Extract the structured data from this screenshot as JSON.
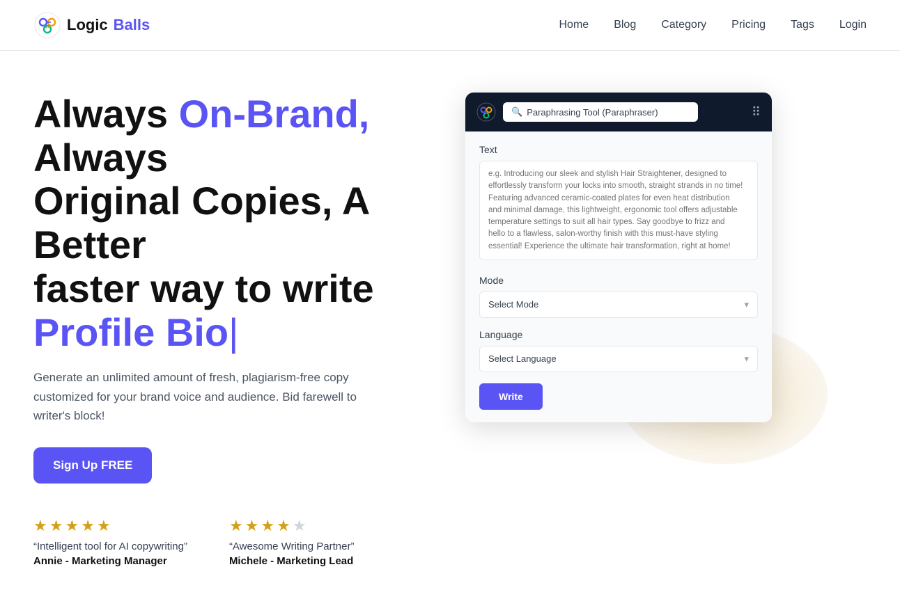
{
  "header": {
    "logo_logic": "Logic",
    "logo_balls": "Balls",
    "nav": {
      "home": "Home",
      "blog": "Blog",
      "category": "Category",
      "pricing": "Pricing",
      "tags": "Tags",
      "login": "Login"
    }
  },
  "hero": {
    "line1": "Always ",
    "line1_accent": "On-Brand,",
    "line1_end": " Always",
    "line2": "Original Copies, A Better",
    "line3": "faster way to write",
    "line4_accent": "Profile Bio",
    "cursor": "|",
    "subtitle": "Generate an unlimited amount of fresh, plagiarism-free copy customized for your brand voice and audience. Bid farewell to writer's block!",
    "cta_button": "Sign Up FREE"
  },
  "reviews": [
    {
      "stars": 5,
      "quote": "“Intelligent tool for AI copywriting”",
      "author": "Annie - Marketing Manager"
    },
    {
      "stars": 4,
      "quote": "“Awesome Writing Partner”",
      "author": "Michele - Marketing Lead"
    }
  ],
  "tool": {
    "search_placeholder": "Paraphrasing Tool (Paraphraser)",
    "text_label": "Text",
    "textarea_placeholder": "e.g. Introducing our sleek and stylish Hair Straightener, designed to effortlessly transform your locks into smooth, straight strands in no time! Featuring advanced ceramic-coated plates for even heat distribution and minimal damage, this lightweight, ergonomic tool offers adjustable temperature settings to suit all hair types. Say goodbye to frizz and hello to a flawless, salon-worthy finish with this must-have styling essential! Experience the ultimate hair transformation, right at home!",
    "mode_label": "Mode",
    "mode_placeholder": "Select Mode",
    "language_label": "Language",
    "language_placeholder": "Select Language",
    "write_button": "Write"
  },
  "colors": {
    "accent": "#5b54f5",
    "star": "#d4a017",
    "dark_header": "#0f1b2d"
  }
}
